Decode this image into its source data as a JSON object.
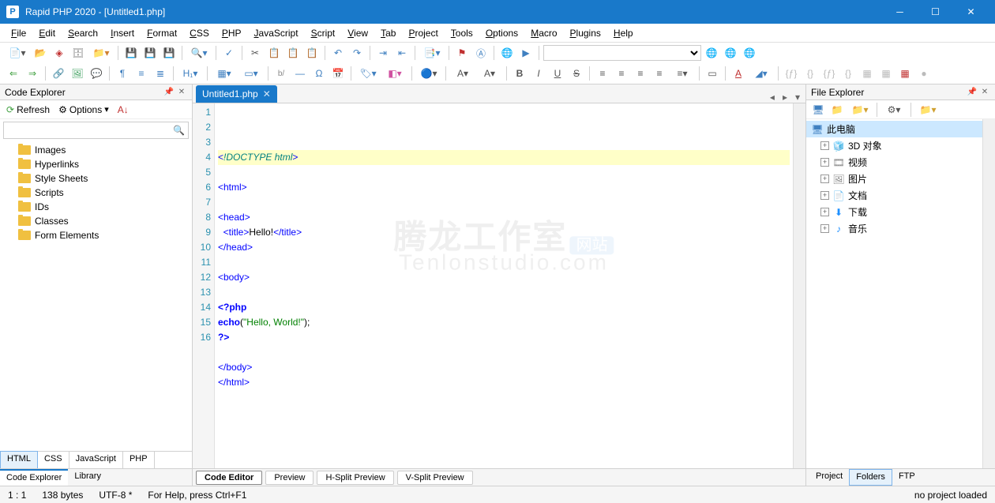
{
  "window": {
    "title": "Rapid PHP 2020 - [Untitled1.php]",
    "app_icon_letter": "P"
  },
  "menu": [
    "File",
    "Edit",
    "Search",
    "Insert",
    "Format",
    "CSS",
    "PHP",
    "JavaScript",
    "Script",
    "View",
    "Tab",
    "Project",
    "Tools",
    "Options",
    "Macro",
    "Plugins",
    "Help"
  ],
  "left_panel": {
    "title": "Code Explorer",
    "refresh": "Refresh",
    "options": "Options",
    "items": [
      "Images",
      "Hyperlinks",
      "Style Sheets",
      "Scripts",
      "IDs",
      "Classes",
      "Form Elements"
    ],
    "lang_tabs": [
      "HTML",
      "CSS",
      "JavaScript",
      "PHP"
    ],
    "bottom_tabs": [
      "Code Explorer",
      "Library"
    ]
  },
  "doc_tab": "Untitled1.php",
  "code_lines": [
    {
      "n": "1",
      "html": "<span class='tag'>&lt;</span><span class='doctype'>!DOCTYPE html</span><span class='tag'>&gt;</span>",
      "hl": true
    },
    {
      "n": "2",
      "html": ""
    },
    {
      "n": "3",
      "html": "<span class='tag'>&lt;html&gt;</span>"
    },
    {
      "n": "4",
      "html": ""
    },
    {
      "n": "5",
      "html": "<span class='tag'>&lt;head&gt;</span>"
    },
    {
      "n": "6",
      "html": "  <span class='tag'>&lt;title&gt;</span><span class='text'>Hello!</span><span class='tag'>&lt;/title&gt;</span>"
    },
    {
      "n": "7",
      "html": "<span class='tag'>&lt;/head&gt;</span>"
    },
    {
      "n": "8",
      "html": ""
    },
    {
      "n": "9",
      "html": "<span class='tag'>&lt;body&gt;</span>"
    },
    {
      "n": "10",
      "html": ""
    },
    {
      "n": "11",
      "html": "<span class='php-tag'>&lt;?php</span>"
    },
    {
      "n": "12",
      "html": "<span class='kw'>echo</span>(<span class='str'>\"Hello, World!\"</span>);"
    },
    {
      "n": "13",
      "html": "<span class='php-tag'>?&gt;</span>"
    },
    {
      "n": "14",
      "html": ""
    },
    {
      "n": "15",
      "html": "<span class='tag'>&lt;/body&gt;</span>"
    },
    {
      "n": "16",
      "html": "<span class='tag'>&lt;/html&gt;</span>"
    }
  ],
  "editor_tabs": [
    "Code Editor",
    "Preview",
    "H-Split Preview",
    "V-Split Preview"
  ],
  "right_panel": {
    "title": "File Explorer",
    "root": "此电脑",
    "items": [
      {
        "icon": "🧊",
        "label": "3D 对象"
      },
      {
        "icon": "🎞",
        "label": "视频"
      },
      {
        "icon": "🖼",
        "label": "图片"
      },
      {
        "icon": "📄",
        "label": "文档"
      },
      {
        "icon": "⬇",
        "label": "下载",
        "color": "#1e90ff"
      },
      {
        "icon": "♪",
        "label": "音乐",
        "color": "#1e90ff"
      }
    ],
    "tabs": [
      "Project",
      "Folders",
      "FTP"
    ]
  },
  "watermark": {
    "line1": "腾龙工作室",
    "badge": "网站",
    "line2": "Tenlonstudio.com"
  },
  "status": {
    "pos": "1 : 1",
    "size": "138 bytes",
    "encoding": "UTF-8 *",
    "help": "For Help, press Ctrl+F1",
    "project": "no project loaded"
  }
}
